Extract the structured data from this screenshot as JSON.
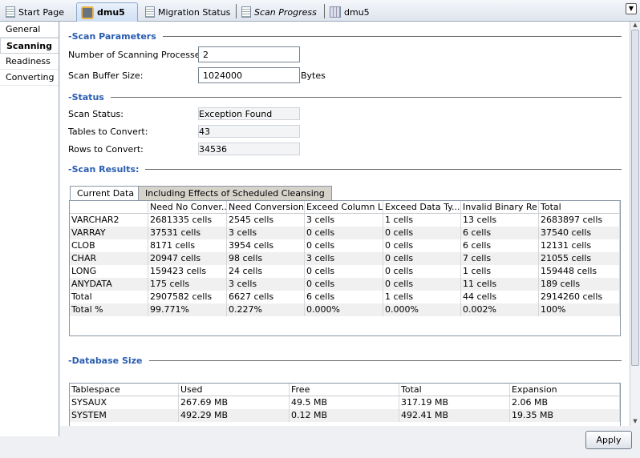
{
  "tabs": [
    {
      "label": "Start Page",
      "icon": "document-icon"
    },
    {
      "label": "dmu5",
      "icon": "database-icon",
      "active": true
    },
    {
      "label": "Migration Status",
      "icon": "document-icon"
    },
    {
      "label": "Scan Progress",
      "icon": "document-icon",
      "italic": true
    },
    {
      "label": "dmu5",
      "icon": "table-icon"
    }
  ],
  "nav": [
    "General",
    "Scanning",
    "Readiness",
    "Converting"
  ],
  "scan_parameters": {
    "title": "Scan Parameters",
    "processes_label": "Number of Scanning Processes:",
    "processes_value": "2",
    "buffer_label": "Scan Buffer Size:",
    "buffer_value": "1024000",
    "buffer_unit": "Bytes"
  },
  "status": {
    "title": "Status",
    "scan_status_label": "Scan Status:",
    "scan_status_value": "Exception Found",
    "tables_label": "Tables to Convert:",
    "tables_value": "43",
    "rows_label": "Rows to Convert:",
    "rows_value": "34536"
  },
  "scan_results": {
    "title": "Scan Results:",
    "tabs": [
      "Current Data",
      "Including Effects of Scheduled Cleansing"
    ],
    "columns": [
      "",
      "Need No Conver...",
      "Need Conversion",
      "Exceed Column L...",
      "Exceed Data Ty...",
      "Invalid Binary Re...",
      "Total"
    ],
    "rows": [
      [
        "VARCHAR2",
        "2681335 cells",
        "2545 cells",
        "3 cells",
        "1 cells",
        "13 cells",
        "2683897 cells"
      ],
      [
        "VARRAY",
        "37531 cells",
        "3 cells",
        "0 cells",
        "0 cells",
        "6 cells",
        "37540 cells"
      ],
      [
        "CLOB",
        "8171 cells",
        "3954 cells",
        "0 cells",
        "0 cells",
        "6 cells",
        "12131 cells"
      ],
      [
        "CHAR",
        "20947 cells",
        "98 cells",
        "3 cells",
        "0 cells",
        "7 cells",
        "21055 cells"
      ],
      [
        "LONG",
        "159423 cells",
        "24 cells",
        "0 cells",
        "0 cells",
        "1 cells",
        "159448 cells"
      ],
      [
        "ANYDATA",
        "175 cells",
        "3 cells",
        "0 cells",
        "0 cells",
        "11 cells",
        "189 cells"
      ],
      [
        "Total",
        "2907582 cells",
        "6627 cells",
        "6 cells",
        "1 cells",
        "44 cells",
        "2914260 cells"
      ],
      [
        "Total %",
        "99.771%",
        "0.227%",
        "0.000%",
        "0.000%",
        "0.002%",
        "100%"
      ]
    ]
  },
  "database_size": {
    "title": "Database Size",
    "columns": [
      "Tablespace",
      "Used",
      "Free",
      "Total",
      "Expansion"
    ],
    "rows": [
      [
        "SYSAUX",
        "267.69 MB",
        "49.5 MB",
        "317.19 MB",
        "2.06 MB"
      ],
      [
        "SYSTEM",
        "492.29 MB",
        "0.12 MB",
        "492.41 MB",
        "19.35 MB"
      ]
    ]
  },
  "apply_label": "Apply"
}
